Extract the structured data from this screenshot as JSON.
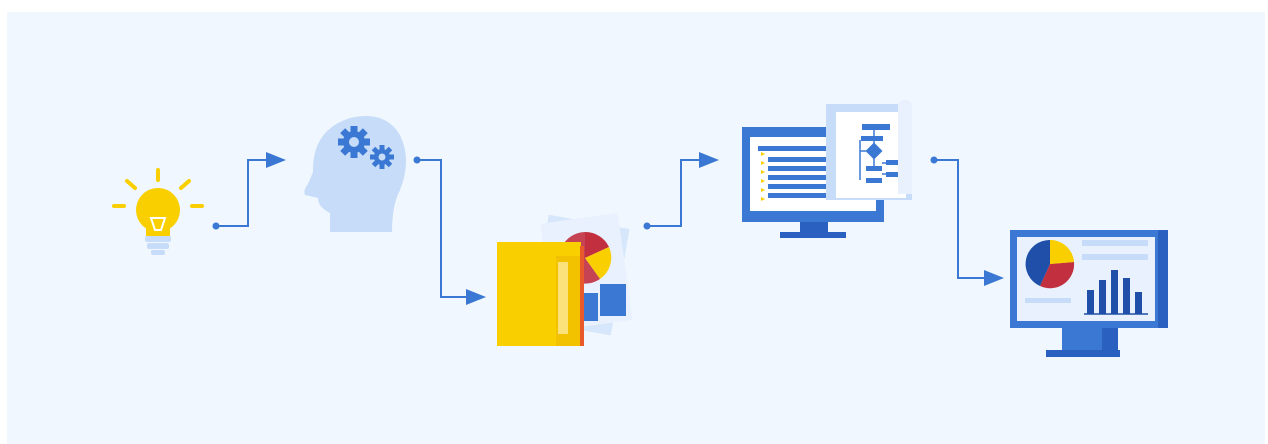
{
  "colors": {
    "background": "#f0f7fe",
    "accent_blue": "#3a78d4",
    "dark_blue": "#1f4fa8",
    "light_blue": "#c6dcf8",
    "yellow": "#f9cf00",
    "red": "#c23040"
  },
  "steps": [
    {
      "icon": "lightbulb-icon",
      "meaning": "idea"
    },
    {
      "icon": "brain-gears-icon",
      "meaning": "thinking"
    },
    {
      "icon": "folder-charts-icon",
      "meaning": "data-collection"
    },
    {
      "icon": "monitor-flowchart-icon",
      "meaning": "planning"
    },
    {
      "icon": "dashboard-monitor-icon",
      "meaning": "report"
    }
  ]
}
